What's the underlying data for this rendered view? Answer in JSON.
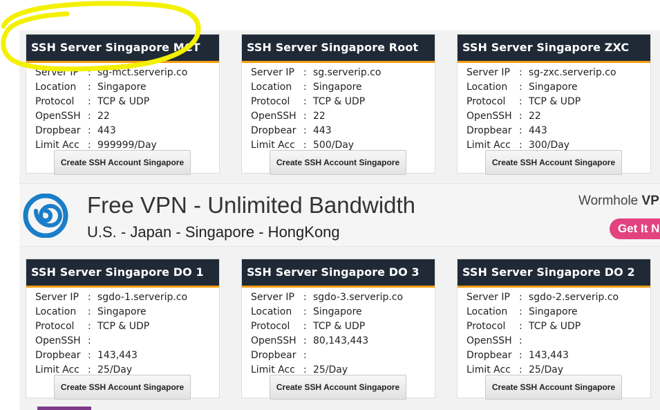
{
  "cards": [
    {
      "title": "SSH Server Singapore MCT",
      "rows": [
        [
          "Server IP",
          ":",
          "sg-mct.serverip.co"
        ],
        [
          "Location",
          ":",
          "Singapore"
        ],
        [
          "Protocol",
          ":",
          "TCP & UDP"
        ],
        [
          "OpenSSH",
          ":",
          "22"
        ],
        [
          "Dropbear",
          ":",
          "443"
        ],
        [
          "Limit Acc",
          ":",
          "999999/Day"
        ]
      ],
      "button": "Create SSH Account Singapore"
    },
    {
      "title": "SSH Server Singapore Root",
      "rows": [
        [
          "Server IP",
          ":",
          "sg.serverip.co"
        ],
        [
          "Location",
          ":",
          "Singapore"
        ],
        [
          "Protocol",
          ":",
          "TCP & UDP"
        ],
        [
          "OpenSSH",
          ":",
          "22"
        ],
        [
          "Dropbear",
          ":",
          "443"
        ],
        [
          "Limit Acc",
          ":",
          "500/Day"
        ]
      ],
      "button": "Create SSH Account Singapore"
    },
    {
      "title": "SSH Server Singapore ZXC",
      "rows": [
        [
          "Server IP",
          ":",
          "sg-zxc.serverip.co"
        ],
        [
          "Location",
          ":",
          "Singapore"
        ],
        [
          "Protocol",
          ":",
          "TCP & UDP"
        ],
        [
          "OpenSSH",
          ":",
          "22"
        ],
        [
          "Dropbear",
          ":",
          "443"
        ],
        [
          "Limit Acc",
          ":",
          "300/Day"
        ]
      ],
      "button": "Create SSH Account Singapore"
    },
    {
      "title": "SSH Server Singapore DO 1",
      "rows": [
        [
          "Server IP",
          ":",
          "sgdo-1.serverip.co"
        ],
        [
          "Location",
          ":",
          "Singapore"
        ],
        [
          "Protocol",
          ":",
          "TCP & UDP"
        ],
        [
          "OpenSSH",
          ":",
          ""
        ],
        [
          "Dropbear",
          ":",
          "143,443"
        ],
        [
          "Limit Acc",
          ":",
          "25/Day"
        ]
      ],
      "button": "Create SSH Account Singapore"
    },
    {
      "title": "SSH Server Singapore DO 3",
      "rows": [
        [
          "Server IP",
          ":",
          "sgdo-3.serverip.co"
        ],
        [
          "Location",
          ":",
          "Singapore"
        ],
        [
          "Protocol",
          ":",
          "TCP & UDP"
        ],
        [
          "OpenSSH",
          ":",
          "80,143,443"
        ],
        [
          "Dropbear",
          ":",
          ""
        ],
        [
          "Limit Acc",
          ":",
          "25/Day"
        ]
      ],
      "button": "Create SSH Account Singapore"
    },
    {
      "title": "SSH Server Singapore DO 2",
      "rows": [
        [
          "Server IP",
          ":",
          "sgdo-2.serverip.co"
        ],
        [
          "Location",
          ":",
          "Singapore"
        ],
        [
          "Protocol",
          ":",
          "TCP & UDP"
        ],
        [
          "OpenSSH",
          ":",
          ""
        ],
        [
          "Dropbear",
          ":",
          "143,443"
        ],
        [
          "Limit Acc",
          ":",
          "25/Day"
        ]
      ],
      "button": "Create SSH Account Singapore"
    }
  ],
  "ad": {
    "title": "Free VPN - Unlimited Bandwidth",
    "subtitle": "U.S. - Japan - Singapore - HongKong",
    "brand_prefix": "Wormhole ",
    "brand_suffix": "VP",
    "cta": "Get It N",
    "logo_icon": "spiral-logo-icon"
  },
  "colors": {
    "card_header": "#1f2a36",
    "accent": "#f39c12",
    "highlight": "#f3f000",
    "cta": "#e2427f"
  }
}
